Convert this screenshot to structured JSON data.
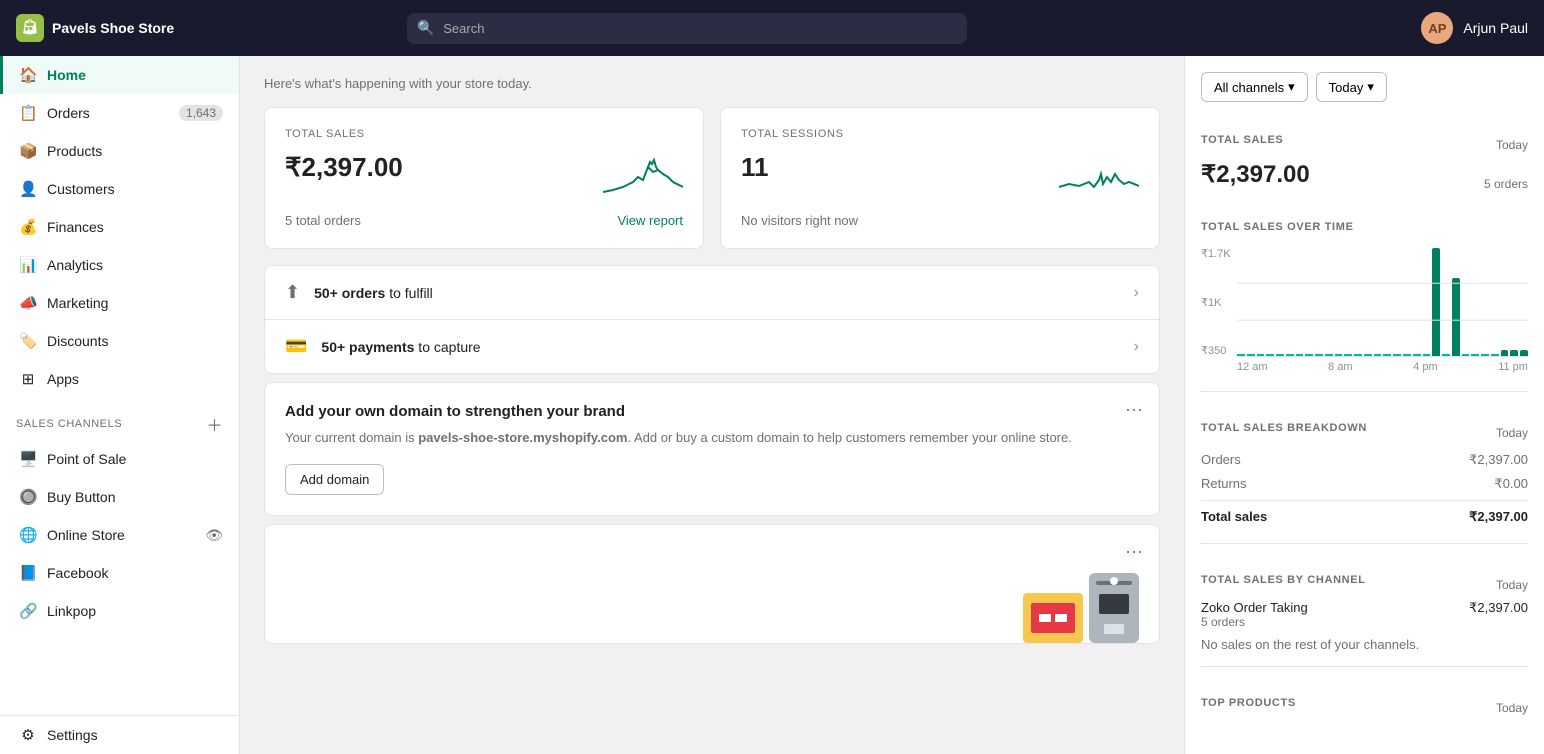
{
  "app": {
    "store_name": "Pavels Shoe Store",
    "user_initials": "AP",
    "user_name": "Arjun Paul",
    "search_placeholder": "Search"
  },
  "sidebar": {
    "main_items": [
      {
        "id": "home",
        "label": "Home",
        "icon": "🏠",
        "active": true,
        "badge": null
      },
      {
        "id": "orders",
        "label": "Orders",
        "icon": "📋",
        "active": false,
        "badge": "1,643"
      },
      {
        "id": "products",
        "label": "Products",
        "icon": "📦",
        "active": false,
        "badge": null
      },
      {
        "id": "customers",
        "label": "Customers",
        "icon": "👤",
        "active": false,
        "badge": null
      },
      {
        "id": "finances",
        "label": "Finances",
        "icon": "💰",
        "active": false,
        "badge": null
      },
      {
        "id": "analytics",
        "label": "Analytics",
        "icon": "📊",
        "active": false,
        "badge": null
      },
      {
        "id": "marketing",
        "label": "Marketing",
        "icon": "📣",
        "active": false,
        "badge": null
      },
      {
        "id": "discounts",
        "label": "Discounts",
        "icon": "🏷️",
        "active": false,
        "badge": null
      },
      {
        "id": "apps",
        "label": "Apps",
        "icon": "⊞",
        "active": false,
        "badge": null
      }
    ],
    "sales_channels_label": "Sales channels",
    "sales_channel_items": [
      {
        "id": "pos",
        "label": "Point of Sale",
        "icon": "🖥️"
      },
      {
        "id": "buy-button",
        "label": "Buy Button",
        "icon": "🔘"
      },
      {
        "id": "online-store",
        "label": "Online Store",
        "icon": "🌐",
        "eye": true
      },
      {
        "id": "facebook",
        "label": "Facebook",
        "icon": "📘"
      },
      {
        "id": "linkpop",
        "label": "Linkpop",
        "icon": "🔗"
      }
    ],
    "settings_label": "Settings"
  },
  "main": {
    "header_text": "Here's what's happening with your store today.",
    "total_sales_card": {
      "title": "TOTAL SALES",
      "value": "₹2,397.00",
      "footer_text": "5 total orders",
      "view_report": "View report"
    },
    "total_sessions_card": {
      "title": "TOTAL SESSIONS",
      "value": "11",
      "footer_text": "No visitors right now"
    },
    "action_items": [
      {
        "icon": "⬆",
        "text_bold": "50+ orders",
        "text_normal": " to fulfill"
      },
      {
        "icon": "💳",
        "text_bold": "50+ payments",
        "text_normal": " to capture"
      }
    ],
    "domain_card": {
      "title": "Add your own domain to strengthen your brand",
      "description_before": "Your current domain is ",
      "domain": "pavels-shoe-store.myshopify.com",
      "description_after": ". Add or buy a custom domain to help customers remember your online store.",
      "button_label": "Add domain"
    }
  },
  "right_panel": {
    "filter_all_channels": "All channels",
    "filter_today": "Today",
    "total_sales_section": {
      "title": "TOTAL SALES",
      "today_label": "Today",
      "value": "₹2,397.00",
      "orders_label": "5 orders"
    },
    "chart": {
      "title": "TOTAL SALES OVER TIME",
      "y_labels": [
        "₹1.7K",
        "₹1K",
        "₹350"
      ],
      "x_labels": [
        "12 am",
        "8 am",
        "4 pm",
        "11 pm"
      ],
      "bars": [
        0,
        0,
        0,
        0,
        0,
        0,
        0,
        0,
        0,
        0,
        0,
        0,
        0,
        0,
        0,
        0,
        0,
        0,
        0,
        0,
        90,
        0,
        65,
        0,
        0,
        0,
        0,
        5,
        5,
        5
      ]
    },
    "breakdown": {
      "title": "TOTAL SALES BREAKDOWN",
      "today_label": "Today",
      "rows": [
        {
          "label": "Orders",
          "value": "₹2,397.00"
        },
        {
          "label": "Returns",
          "value": "₹0.00"
        }
      ],
      "total_label": "Total sales",
      "total_value": "₹2,397.00"
    },
    "by_channel": {
      "title": "TOTAL SALES BY CHANNEL",
      "today_label": "Today",
      "channel_name": "Zoko Order Taking",
      "channel_value": "₹2,397.00",
      "channel_orders": "5 orders",
      "no_sales_text": "No sales on the rest of your channels."
    },
    "top_products": {
      "title": "TOP PRODUCTS",
      "today_label": "Today"
    }
  }
}
